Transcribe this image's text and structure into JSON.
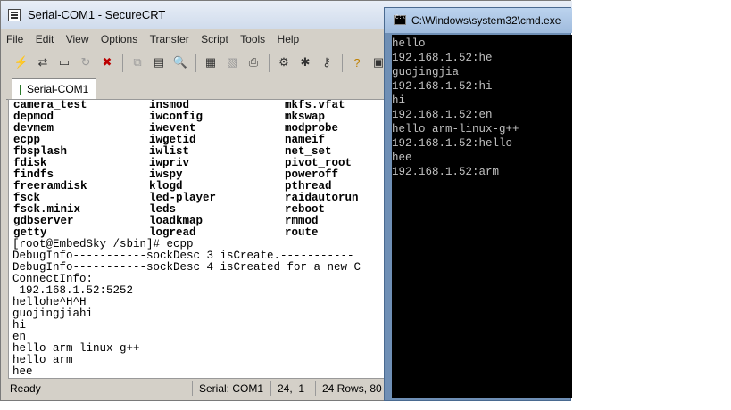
{
  "crt": {
    "title": "Serial-COM1 - SecureCRT",
    "menu": [
      "File",
      "Edit",
      "View",
      "Options",
      "Transfer",
      "Script",
      "Tools",
      "Help"
    ],
    "tab_label": "Serial-COM1",
    "command_columns": [
      [
        "camera_test",
        "insmod",
        "mkfs.vfat"
      ],
      [
        "depmod",
        "iwconfig",
        "mkswap"
      ],
      [
        "devmem",
        "iwevent",
        "modprobe"
      ],
      [
        "ecpp",
        "iwgetid",
        "nameif"
      ],
      [
        "fbsplash",
        "iwlist",
        "net_set"
      ],
      [
        "fdisk",
        "iwpriv",
        "pivot_root"
      ],
      [
        "findfs",
        "iwspy",
        "poweroff"
      ],
      [
        "freeramdisk",
        "klogd",
        "pthread"
      ],
      [
        "fsck",
        "led-player",
        "raidautorun"
      ],
      [
        "fsck.minix",
        "leds",
        "reboot"
      ],
      [
        "gdbserver",
        "loadkmap",
        "rmmod"
      ],
      [
        "getty",
        "logread",
        "route"
      ]
    ],
    "output_lines": [
      "[root@EmbedSky /sbin]# ecpp",
      "DebugInfo-----------sockDesc 3 isCreate.-----------",
      "DebugInfo-----------sockDesc 4 isCreated for a new C",
      "ConnectInfo:",
      " 192.168.1.52:5252",
      "hellohe^H^H",
      "guojingjiahi",
      "hi",
      "en",
      "hello arm-linux-g++",
      "hello arm",
      "hee"
    ],
    "status": {
      "ready": "Ready",
      "serial": "Serial: COM1",
      "position": "24,  1",
      "size": "24 Rows, 80"
    }
  },
  "cmd": {
    "title": "C:\\Windows\\system32\\cmd.exe",
    "lines": [
      "hello",
      "192.168.1.52:he",
      "guojingjia",
      "192.168.1.52:hi",
      "hi",
      "192.168.1.52:en",
      "hello arm-linux-g++",
      "192.168.1.52:hello",
      "hee",
      "192.168.1.52:arm"
    ]
  }
}
